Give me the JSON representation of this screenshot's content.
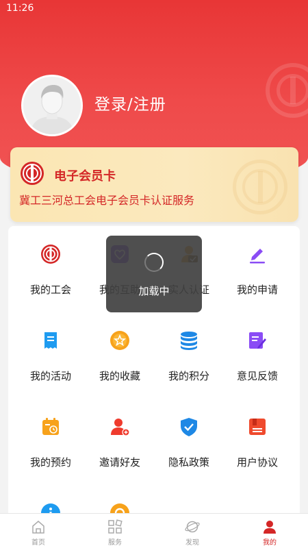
{
  "status_bar": {
    "time": "11:26"
  },
  "profile": {
    "login_label": "登录/注册"
  },
  "member_card": {
    "title": "电子会员卡",
    "description": "冀工三河总工会电子会员卡认证服务"
  },
  "grid": [
    {
      "label": "我的工会",
      "icon": "union-logo-icon"
    },
    {
      "label": "我的互助",
      "icon": "heart-frame-icon"
    },
    {
      "label": "实人认证",
      "icon": "person-verify-icon"
    },
    {
      "label": "我的申请",
      "icon": "edit-pen-icon"
    },
    {
      "label": "我的活动",
      "icon": "receipt-icon"
    },
    {
      "label": "我的收藏",
      "icon": "star-coin-icon"
    },
    {
      "label": "我的积分",
      "icon": "database-stack-icon"
    },
    {
      "label": "意见反馈",
      "icon": "feedback-note-icon"
    },
    {
      "label": "我的预约",
      "icon": "calendar-clock-icon"
    },
    {
      "label": "邀请好友",
      "icon": "add-friend-icon"
    },
    {
      "label": "隐私政策",
      "icon": "shield-check-icon"
    },
    {
      "label": "用户协议",
      "icon": "agreement-icon"
    },
    {
      "label": "",
      "icon": "info-icon"
    },
    {
      "label": "",
      "icon": "gear-icon"
    }
  ],
  "loading": {
    "text": "加载中"
  },
  "tabbar": [
    {
      "label": "首页",
      "icon": "home-icon"
    },
    {
      "label": "服务",
      "icon": "services-grid-icon"
    },
    {
      "label": "发现",
      "icon": "planet-icon"
    },
    {
      "label": "我的",
      "icon": "user-icon"
    }
  ],
  "colors": {
    "primary_red": "#e83636",
    "card_gold": "#fbe6b3",
    "accent_text": "#d42727"
  }
}
